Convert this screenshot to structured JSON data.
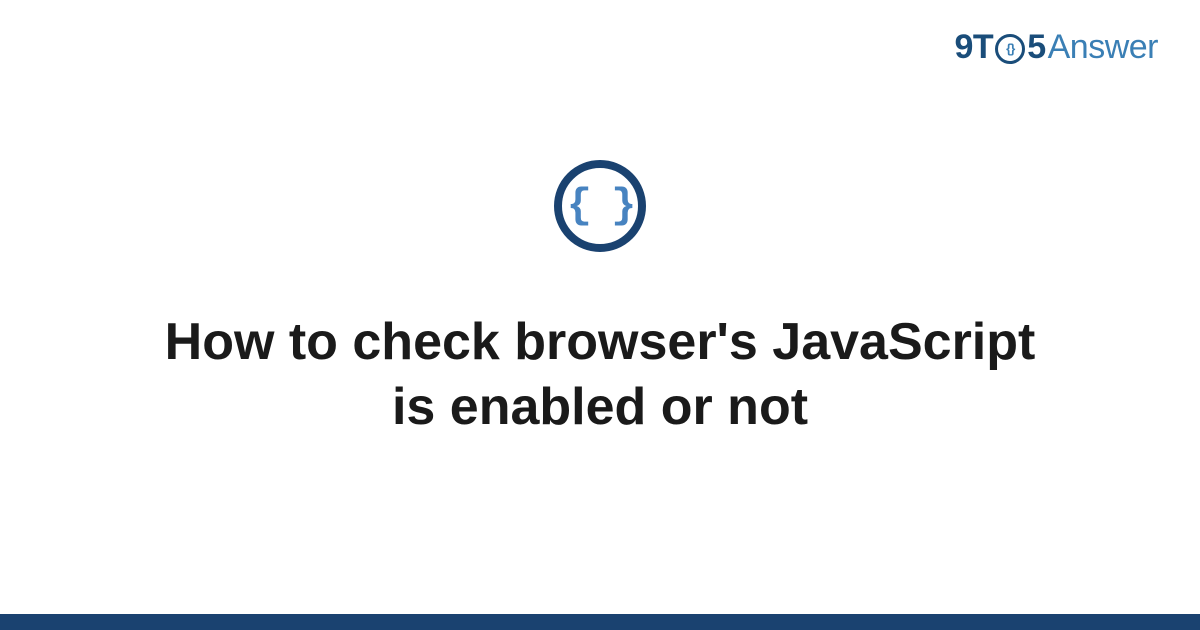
{
  "logo": {
    "nine": "9",
    "t": "T",
    "o_inner": "{}",
    "five": "5",
    "answer": "Answer"
  },
  "icon": {
    "braces": "{ }",
    "name": "code-braces-icon"
  },
  "title": "How to check browser's JavaScript is enabled or not",
  "colors": {
    "brand_dark": "#1a4270",
    "brand_light": "#4783c0",
    "text": "#1a1a1a"
  }
}
